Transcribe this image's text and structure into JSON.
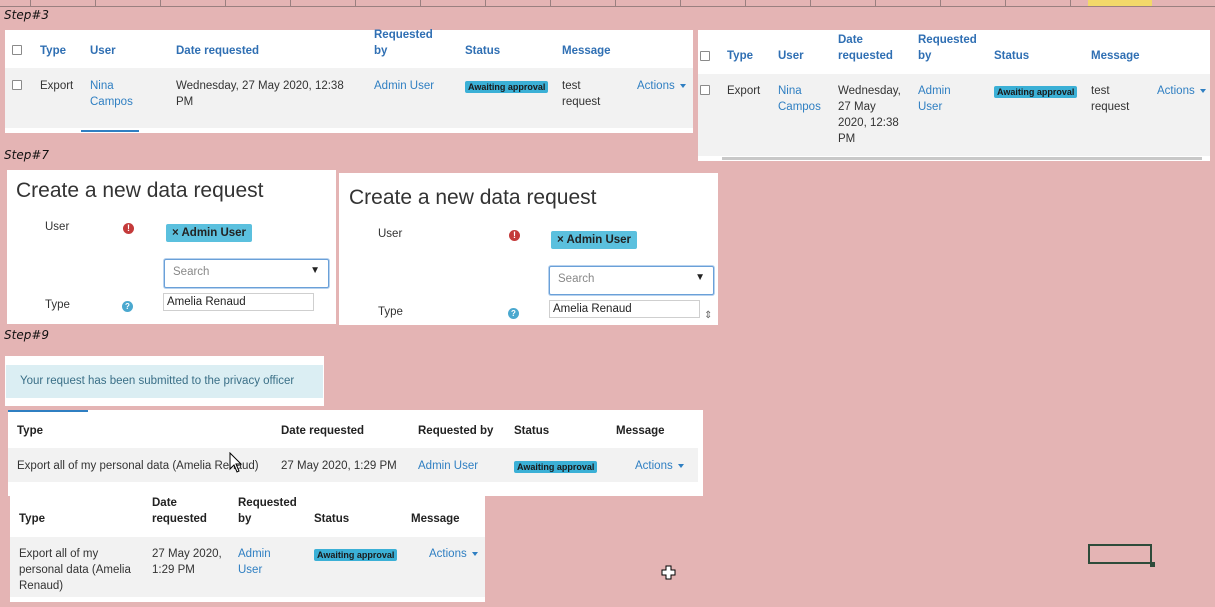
{
  "steps": {
    "s3": "Step#3",
    "s7": "Step#7",
    "s9": "Step#9"
  },
  "requests_table": {
    "headers": {
      "type": "Type",
      "user": "User",
      "date": "Date requested",
      "requested_by_1": "Requested",
      "requested_by_2": "by",
      "status": "Status",
      "message": "Message"
    },
    "row": {
      "type": "Export",
      "user_1": "Nina",
      "user_2": "Campos",
      "date_1": "Wednesday, 27 May 2020, 12:38",
      "date_2": "PM",
      "requested_by": "Admin User",
      "status": "Awaiting approval",
      "message_1": "test",
      "message_2": "request",
      "actions": "Actions"
    }
  },
  "requests_table_narrow": {
    "headers": {
      "type": "Type",
      "user": "User",
      "date_1": "Date",
      "date_2": "requested",
      "requested_by_1": "Requested",
      "requested_by_2": "by",
      "status": "Status",
      "message": "Message"
    },
    "row": {
      "type": "Export",
      "user_1": "Nina",
      "user_2": "Campos",
      "date_1": "Wednesday,",
      "date_2": "27 May",
      "date_3": "2020, 12:38",
      "date_4": "PM",
      "requested_by_1": "Admin",
      "requested_by_2": "User",
      "status": "Awaiting approval",
      "message_1": "test",
      "message_2": "request",
      "actions": "Actions"
    }
  },
  "create_form": {
    "title": "Create a new data request",
    "user_label": "User",
    "selected_user": "× Admin User",
    "search_placeholder": "Search",
    "type_label": "Type",
    "dropdown_option": "Amelia Renaud",
    "error_icon": "!",
    "help_icon": "?"
  },
  "confirmation": {
    "alert": "Your request has been submitted to the privacy officer"
  },
  "my_requests": {
    "headers": {
      "type": "Type",
      "date": "Date requested",
      "requested_by": "Requested by",
      "status": "Status",
      "message": "Message"
    },
    "row": {
      "type": "Export all of my personal data (Amelia Renaud)",
      "date": "27 May 2020, 1:29 PM",
      "requested_by": "Admin User",
      "status": "Awaiting approval",
      "actions": "Actions"
    }
  },
  "my_requests_narrow": {
    "headers": {
      "type": "Type",
      "date_1": "Date",
      "date_2": "requested",
      "requested_by_1": "Requested",
      "requested_by_2": "by",
      "status": "Status",
      "message": "Message"
    },
    "row": {
      "type_1": "Export all of my",
      "type_2": "personal data (Amelia",
      "type_3": "Renaud)",
      "date_1": "27 May 2020,",
      "date_2": "1:29 PM",
      "requested_by_1": "Admin",
      "requested_by_2": "User",
      "status": "Awaiting approval",
      "actions": "Actions"
    }
  }
}
